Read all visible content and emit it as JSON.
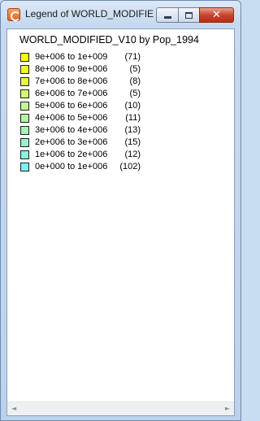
{
  "window": {
    "title": "Legend of WORLD_MODIFIED_V10 by Pop_1994",
    "icon": "map-legend-app-icon",
    "buttons": {
      "minimize": "minimize-icon",
      "maximize": "maximize-icon",
      "close": "close-icon",
      "close_glyph": "✕"
    }
  },
  "legend": {
    "title": "WORLD_MODIFIED_V10 by Pop_1994",
    "items": [
      {
        "range": "9e+006 to 1e+009",
        "count": "(71)",
        "color": "#ffff00"
      },
      {
        "range": "8e+006 to 9e+006",
        "count": "(5)",
        "color": "#f1fd26"
      },
      {
        "range": "7e+006 to 8e+006",
        "count": "(8)",
        "color": "#e2fa4b"
      },
      {
        "range": "6e+006 to 7e+006",
        "count": "(5)",
        "color": "#d3f871"
      },
      {
        "range": "5e+006 to 6e+006",
        "count": "(10)",
        "color": "#c4f596"
      },
      {
        "range": "4e+006 to 5e+006",
        "count": "(11)",
        "color": "#b6f3a6"
      },
      {
        "range": "3e+006 to 4e+006",
        "count": "(13)",
        "color": "#a8f2b8"
      },
      {
        "range": "2e+006 to 3e+006",
        "count": "(15)",
        "color": "#9af1cb"
      },
      {
        "range": "1e+006 to 2e+006",
        "count": "(12)",
        "color": "#8cf0de"
      },
      {
        "range": "0e+000 to 1e+006",
        "count": "(102)",
        "color": "#7eeff2"
      }
    ]
  },
  "scrollbar": {
    "left_glyph": "◄",
    "right_glyph": "►"
  }
}
